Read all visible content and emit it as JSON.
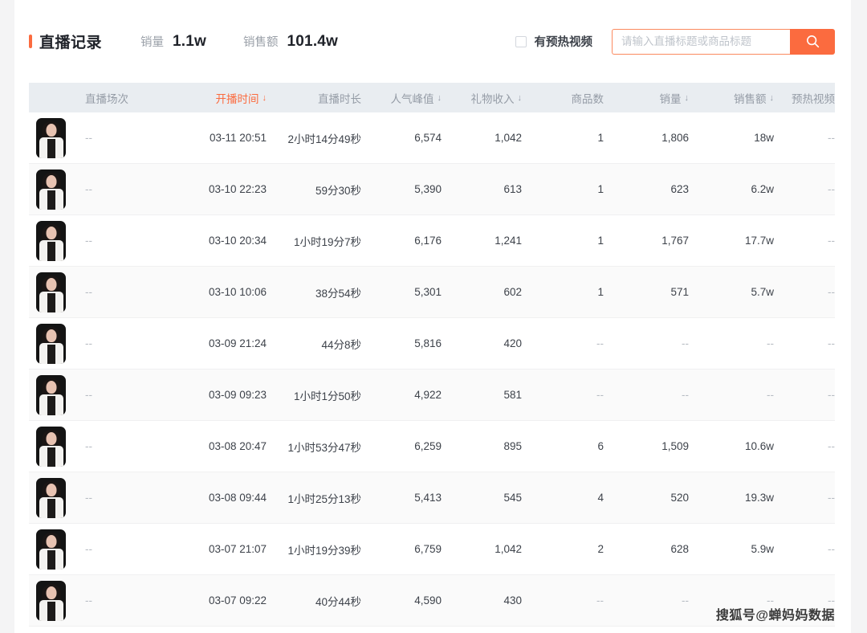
{
  "header": {
    "title": "直播记录",
    "stats": [
      {
        "label": "销量",
        "value": "1.1w"
      },
      {
        "label": "销售额",
        "value": "101.4w"
      }
    ],
    "checkbox": {
      "label": "有预热视频",
      "checked": false
    },
    "search": {
      "placeholder": "请输入直播标题或商品标题",
      "value": "",
      "icon": "search-icon"
    }
  },
  "table": {
    "columns": [
      {
        "key": "avatar",
        "label": "",
        "sortable": false,
        "active": false
      },
      {
        "key": "session",
        "label": "直播场次",
        "sortable": false,
        "active": false
      },
      {
        "key": "start",
        "label": "开播时间",
        "sortable": true,
        "active": true
      },
      {
        "key": "dur",
        "label": "直播时长",
        "sortable": false,
        "active": false
      },
      {
        "key": "peak",
        "label": "人气峰值",
        "sortable": true,
        "active": false
      },
      {
        "key": "gift",
        "label": "礼物收入",
        "sortable": true,
        "active": false
      },
      {
        "key": "goods",
        "label": "商品数",
        "sortable": false,
        "active": false
      },
      {
        "key": "sales",
        "label": "销量",
        "sortable": true,
        "active": false
      },
      {
        "key": "gmv",
        "label": "销售额",
        "sortable": true,
        "active": false
      },
      {
        "key": "video",
        "label": "预热视频",
        "sortable": false,
        "active": false
      }
    ],
    "sort_icon": "↓",
    "empty": "--",
    "rows": [
      {
        "session": "--",
        "start": "03-11 20:51",
        "dur": "2小时14分49秒",
        "peak": "6,574",
        "gift": "1,042",
        "goods": "1",
        "sales": "1,806",
        "gmv": "18w",
        "video": "--"
      },
      {
        "session": "--",
        "start": "03-10 22:23",
        "dur": "59分30秒",
        "peak": "5,390",
        "gift": "613",
        "goods": "1",
        "sales": "623",
        "gmv": "6.2w",
        "video": "--"
      },
      {
        "session": "--",
        "start": "03-10 20:34",
        "dur": "1小时19分7秒",
        "peak": "6,176",
        "gift": "1,241",
        "goods": "1",
        "sales": "1,767",
        "gmv": "17.7w",
        "video": "--"
      },
      {
        "session": "--",
        "start": "03-10 10:06",
        "dur": "38分54秒",
        "peak": "5,301",
        "gift": "602",
        "goods": "1",
        "sales": "571",
        "gmv": "5.7w",
        "video": "--"
      },
      {
        "session": "--",
        "start": "03-09 21:24",
        "dur": "44分8秒",
        "peak": "5,816",
        "gift": "420",
        "goods": "--",
        "sales": "--",
        "gmv": "--",
        "video": "--"
      },
      {
        "session": "--",
        "start": "03-09 09:23",
        "dur": "1小时1分50秒",
        "peak": "4,922",
        "gift": "581",
        "goods": "--",
        "sales": "--",
        "gmv": "--",
        "video": "--"
      },
      {
        "session": "--",
        "start": "03-08 20:47",
        "dur": "1小时53分47秒",
        "peak": "6,259",
        "gift": "895",
        "goods": "6",
        "sales": "1,509",
        "gmv": "10.6w",
        "video": "--"
      },
      {
        "session": "--",
        "start": "03-08 09:44",
        "dur": "1小时25分13秒",
        "peak": "5,413",
        "gift": "545",
        "goods": "4",
        "sales": "520",
        "gmv": "19.3w",
        "video": "--"
      },
      {
        "session": "--",
        "start": "03-07 21:07",
        "dur": "1小时19分39秒",
        "peak": "6,759",
        "gift": "1,042",
        "goods": "2",
        "sales": "628",
        "gmv": "5.9w",
        "video": "--"
      },
      {
        "session": "--",
        "start": "03-07 09:22",
        "dur": "40分44秒",
        "peak": "4,590",
        "gift": "430",
        "goods": "--",
        "sales": "--",
        "gmv": "--",
        "video": "--"
      }
    ]
  },
  "watermark": "搜狐号@蝉妈妈数据",
  "colors": {
    "accent": "#fb6b3f",
    "header_row_bg": "#e9edf1",
    "alt_row_bg": "#fafafa",
    "page_bg": "#f4f4f5",
    "muted_text": "#b7bcc3"
  }
}
